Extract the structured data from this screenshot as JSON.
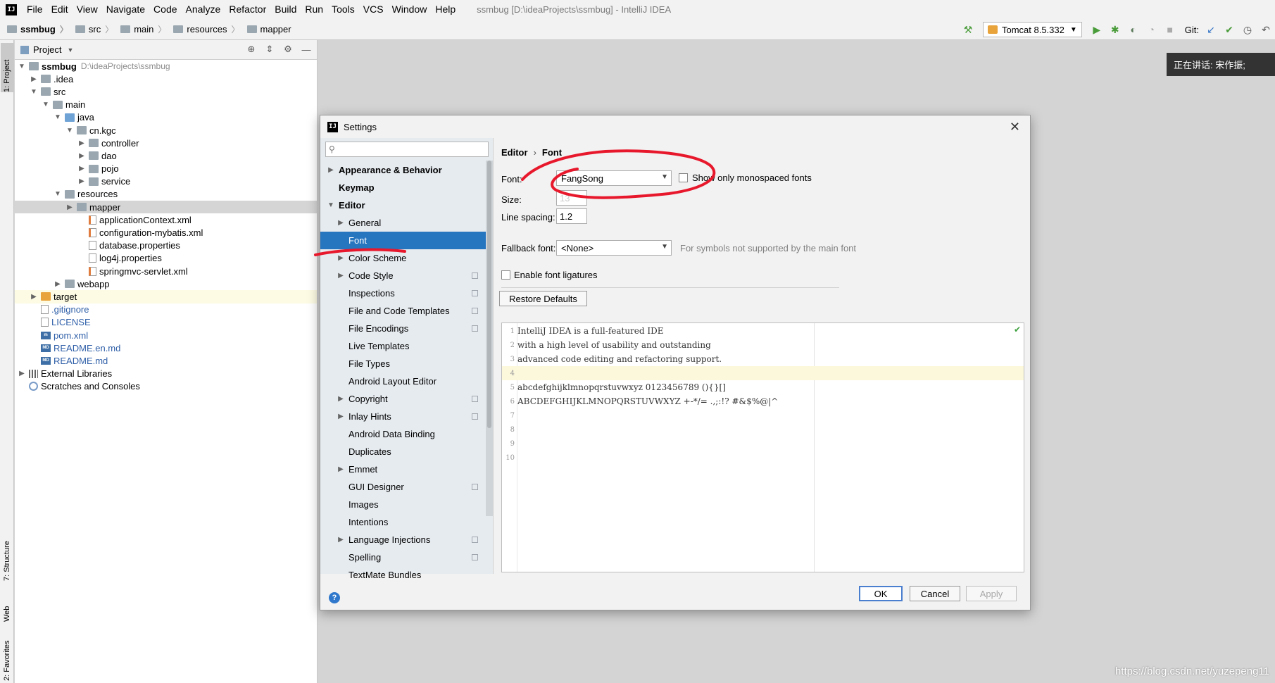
{
  "app": {
    "logo_text": "IJ",
    "menus": [
      "File",
      "Edit",
      "View",
      "Navigate",
      "Code",
      "Analyze",
      "Refactor",
      "Build",
      "Run",
      "Tools",
      "VCS",
      "Window",
      "Help"
    ],
    "window_title": "ssmbug [D:\\ideaProjects\\ssmbug] - IntelliJ IDEA"
  },
  "navbar": {
    "breadcrumbs": [
      "ssmbug",
      "src",
      "main",
      "resources",
      "mapper"
    ],
    "run_config": "Tomcat 8.5.332",
    "git_label": "Git:"
  },
  "left_strip": {
    "tabs": [
      "1: Project",
      "7: Structure",
      "Web",
      "2: Favorites"
    ]
  },
  "project_panel": {
    "title": "Project",
    "tree": [
      {
        "label": "ssmbug",
        "extra": "D:\\ideaProjects\\ssmbug",
        "depth": 0,
        "arrow": "open",
        "icon": "folder",
        "bold": true
      },
      {
        "label": ".idea",
        "depth": 1,
        "arrow": "closed",
        "icon": "folder"
      },
      {
        "label": "src",
        "depth": 1,
        "arrow": "open",
        "icon": "folder"
      },
      {
        "label": "main",
        "depth": 2,
        "arrow": "open",
        "icon": "folder"
      },
      {
        "label": "java",
        "depth": 3,
        "arrow": "open",
        "icon": "folder-blue"
      },
      {
        "label": "cn.kgc",
        "depth": 4,
        "arrow": "open",
        "icon": "folder"
      },
      {
        "label": "controller",
        "depth": 5,
        "arrow": "closed",
        "icon": "folder"
      },
      {
        "label": "dao",
        "depth": 5,
        "arrow": "closed",
        "icon": "folder"
      },
      {
        "label": "pojo",
        "depth": 5,
        "arrow": "closed",
        "icon": "folder"
      },
      {
        "label": "service",
        "depth": 5,
        "arrow": "closed",
        "icon": "folder"
      },
      {
        "label": "resources",
        "depth": 3,
        "arrow": "open",
        "icon": "folder"
      },
      {
        "label": "mapper",
        "depth": 4,
        "arrow": "closed",
        "icon": "folder",
        "selected": true
      },
      {
        "label": "applicationContext.xml",
        "depth": 5,
        "arrow": "none",
        "icon": "file-xml"
      },
      {
        "label": "configuration-mybatis.xml",
        "depth": 5,
        "arrow": "none",
        "icon": "file-xml"
      },
      {
        "label": "database.properties",
        "depth": 5,
        "arrow": "none",
        "icon": "file"
      },
      {
        "label": "log4j.properties",
        "depth": 5,
        "arrow": "none",
        "icon": "file"
      },
      {
        "label": "springmvc-servlet.xml",
        "depth": 5,
        "arrow": "none",
        "icon": "file-xml"
      },
      {
        "label": "webapp",
        "depth": 3,
        "arrow": "closed",
        "icon": "folder"
      },
      {
        "label": "target",
        "depth": 1,
        "arrow": "closed",
        "icon": "folder-orange",
        "highlight": true
      },
      {
        "label": ".gitignore",
        "depth": 1,
        "arrow": "none",
        "icon": "file",
        "blue": true
      },
      {
        "label": "LICENSE",
        "depth": 1,
        "arrow": "none",
        "icon": "file",
        "blue": true
      },
      {
        "label": "pom.xml",
        "depth": 1,
        "arrow": "none",
        "icon": "file-md",
        "blue": true,
        "icon_text": "m"
      },
      {
        "label": "README.en.md",
        "depth": 1,
        "arrow": "none",
        "icon": "file-md",
        "blue": true,
        "icon_text": "MD"
      },
      {
        "label": "README.md",
        "depth": 1,
        "arrow": "none",
        "icon": "file-md",
        "blue": true,
        "icon_text": "MD"
      },
      {
        "label": "External Libraries",
        "depth": 0,
        "arrow": "closed",
        "icon": "libs"
      },
      {
        "label": "Scratches and Consoles",
        "depth": 0,
        "arrow": "none",
        "icon": "scratch"
      }
    ]
  },
  "notification": "正在讲话: 宋作振;",
  "watermark": "https://blog.csdn.net/yuzepeng11",
  "settings": {
    "title": "Settings",
    "search_placeholder": "",
    "nav": [
      {
        "label": "Appearance & Behavior",
        "bold": true,
        "arrow": "closed",
        "indent": 0
      },
      {
        "label": "Keymap",
        "bold": true,
        "arrow": "none",
        "indent": 0
      },
      {
        "label": "Editor",
        "bold": true,
        "arrow": "open",
        "indent": 0
      },
      {
        "label": "General",
        "arrow": "closed",
        "indent": 1
      },
      {
        "label": "Font",
        "arrow": "none",
        "indent": 1,
        "selected": true
      },
      {
        "label": "Color Scheme",
        "arrow": "closed",
        "indent": 1
      },
      {
        "label": "Code Style",
        "arrow": "closed",
        "indent": 1,
        "badge": true
      },
      {
        "label": "Inspections",
        "arrow": "none",
        "indent": 1,
        "badge": true
      },
      {
        "label": "File and Code Templates",
        "arrow": "none",
        "indent": 1,
        "badge": true
      },
      {
        "label": "File Encodings",
        "arrow": "none",
        "indent": 1,
        "badge": true
      },
      {
        "label": "Live Templates",
        "arrow": "none",
        "indent": 1
      },
      {
        "label": "File Types",
        "arrow": "none",
        "indent": 1
      },
      {
        "label": "Android Layout Editor",
        "arrow": "none",
        "indent": 1
      },
      {
        "label": "Copyright",
        "arrow": "closed",
        "indent": 1,
        "badge": true
      },
      {
        "label": "Inlay Hints",
        "arrow": "closed",
        "indent": 1,
        "badge": true
      },
      {
        "label": "Android Data Binding",
        "arrow": "none",
        "indent": 1
      },
      {
        "label": "Duplicates",
        "arrow": "none",
        "indent": 1
      },
      {
        "label": "Emmet",
        "arrow": "closed",
        "indent": 1
      },
      {
        "label": "GUI Designer",
        "arrow": "none",
        "indent": 1,
        "badge": true
      },
      {
        "label": "Images",
        "arrow": "none",
        "indent": 1
      },
      {
        "label": "Intentions",
        "arrow": "none",
        "indent": 1
      },
      {
        "label": "Language Injections",
        "arrow": "closed",
        "indent": 1,
        "badge": true
      },
      {
        "label": "Spelling",
        "arrow": "none",
        "indent": 1,
        "badge": true
      },
      {
        "label": "TextMate Bundles",
        "arrow": "none",
        "indent": 1
      }
    ],
    "breadcrumb": {
      "parent": "Editor",
      "sep": "›",
      "current": "Font"
    },
    "font_label": "Font:",
    "font_value": "FangSong",
    "mono_label": "Show only monospaced fonts",
    "size_label": "Size:",
    "size_value": "13",
    "spacing_label": "Line spacing:",
    "spacing_value": "1.2",
    "fallback_label": "Fallback font:",
    "fallback_value": "<None>",
    "fallback_hint": "For symbols not supported by the main font",
    "ligatures_label": "Enable font ligatures",
    "restore_button": "Restore Defaults",
    "preview_lines": [
      "IntelliJ IDEA is a full-featured IDE",
      "with a high level of usability and outstanding",
      "advanced code editing and refactoring support.",
      "",
      "abcdefghijklmnopqrstuvwxyz 0123456789 (){}[]",
      "ABCDEFGHIJKLMNOPQRSTUVWXYZ +-*/= .,;:!? #&$%@|^",
      "",
      "",
      "",
      ""
    ],
    "ok_button": "OK",
    "cancel_button": "Cancel",
    "apply_button": "Apply",
    "help_text": "?"
  },
  "colors": {
    "selection_blue": "#2675bf",
    "annotation_red": "#e8182c"
  }
}
